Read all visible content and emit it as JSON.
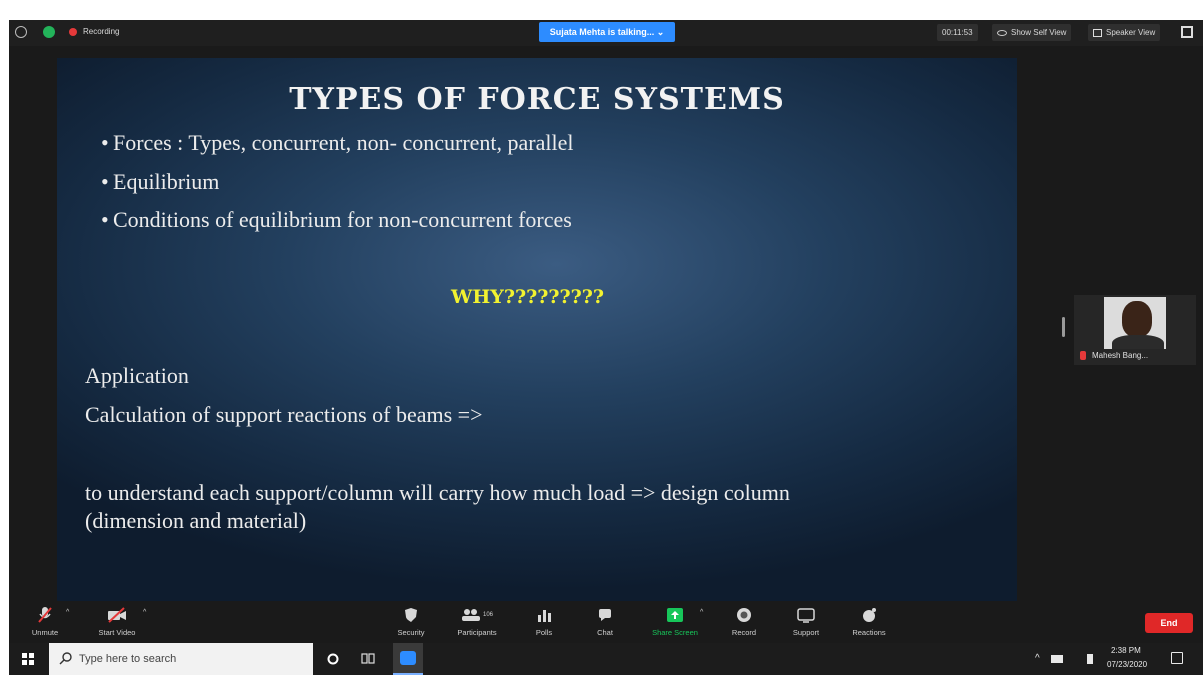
{
  "topbar": {
    "recording_label": "Recording",
    "talking_label": "Sujata Mehta is talking... ⌄",
    "timer": "00:11:53",
    "show_self_view": "Show Self View",
    "speaker_view": "Speaker View"
  },
  "slide": {
    "title": "TYPES OF FORCE SYSTEMS",
    "bullets": [
      "Forces : Types, concurrent, non- concurrent, parallel",
      "Equilibrium",
      "Conditions of equilibrium for non-concurrent forces"
    ],
    "why": "WHY?????????",
    "application_heading": "Application",
    "application_line": "Calculation of support reactions of beams  =>",
    "understand_line1": "to understand each support/column will carry how much load => design column",
    "understand_line2": "(dimension and material)"
  },
  "participant": {
    "name": "Mahesh Bang..."
  },
  "toolbar": {
    "unmute": "Unmute",
    "start_video": "Start Video",
    "security": "Security",
    "participants": "Participants",
    "participants_count": "106",
    "polls": "Polls",
    "chat": "Chat",
    "share_screen": "Share Screen",
    "record": "Record",
    "support": "Support",
    "reactions": "Reactions",
    "end": "End"
  },
  "taskbar": {
    "search_placeholder": "Type here to search",
    "time": "2:38 PM",
    "date": "07/23/2020"
  },
  "colors": {
    "zoom_blue": "#2d8cff",
    "share_green": "#17c65a",
    "end_red": "#e02828",
    "why_yellow": "#f2f230"
  }
}
